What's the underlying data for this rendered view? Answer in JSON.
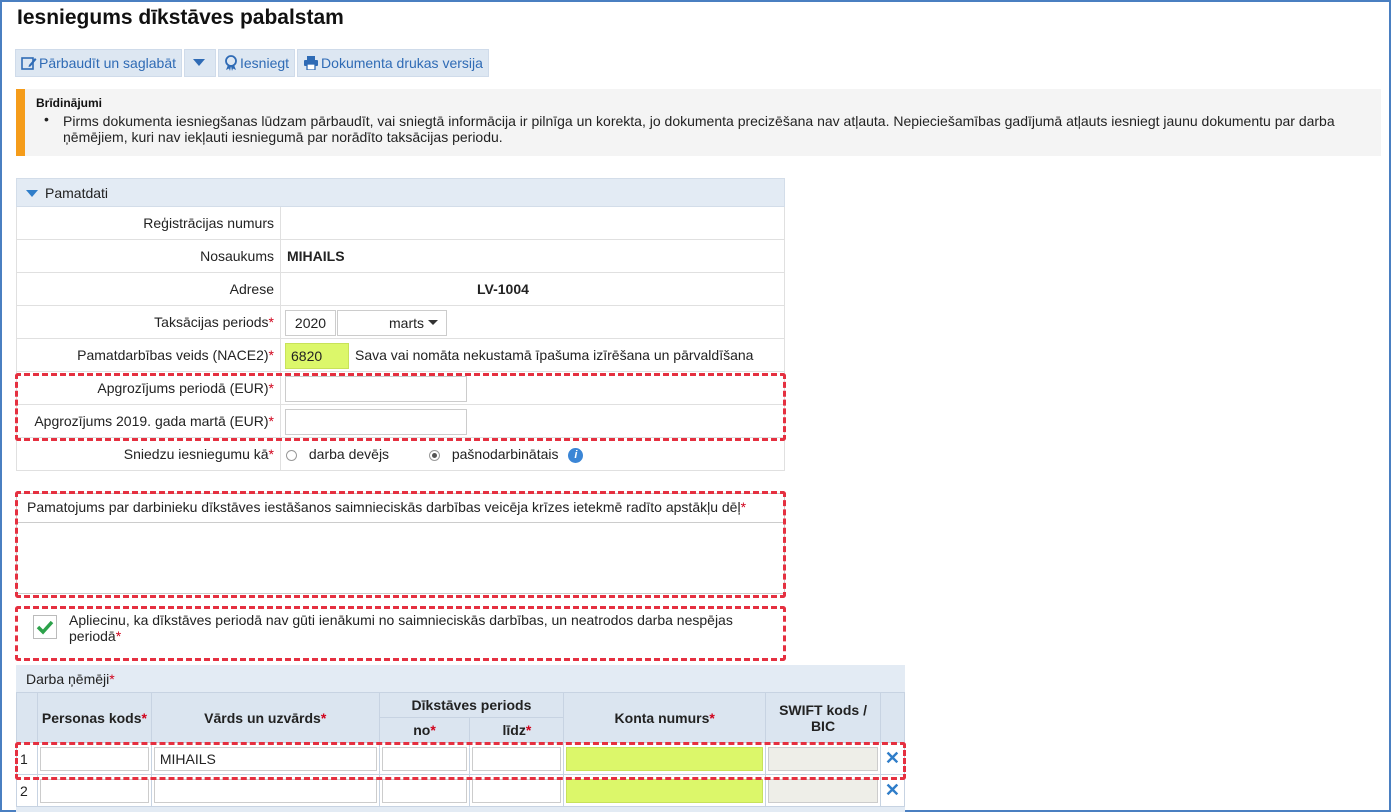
{
  "page": {
    "title": "Iesniegums dīkstāves pabalstam"
  },
  "toolbar": {
    "check_save": "Pārbaudīt un saglabāt",
    "submit": "Iesniegt",
    "print": "Dokumenta drukas versija"
  },
  "warnings": {
    "title": "Brīdinājumi",
    "items": [
      "Pirms dokumenta iesniegšanas lūdzam pārbaudīt, vai sniegtā informācija ir pilnīga un korekta, jo dokumenta precizēšana nav atļauta. Nepieciešamības gadījumā atļauts iesniegt jaunu dokumentu par darba ņēmējiem, kuri nav iekļauti iesniegumā par norādīto taksācijas periodu."
    ]
  },
  "basic": {
    "section_title": "Pamatdati",
    "reg_label": "Reģistrācijas numurs",
    "reg_value": "",
    "name_label": "Nosaukums",
    "name_value": "MIHAILS",
    "address_label": "Adrese",
    "address_value": "LV-1004",
    "period_label": "Taksācijas periods",
    "period_year": "2020",
    "period_month": "marts",
    "nace_label": "Pamatdarbības veids (NACE2)",
    "nace_code": "6820",
    "nace_desc": "Sava vai nomāta nekustamā īpašuma izīrēšana un pārvaldīšana",
    "turnover_label": "Apgrozījums periodā (EUR)",
    "turnover_value": "",
    "turnover2019_label": "Apgrozījums 2019. gada martā (EUR)",
    "turnover2019_value": "",
    "submit_as_label": "Sniedzu iesniegumu kā",
    "option_employer": "darba devējs",
    "option_selfemployed": "pašnodarbinātais",
    "selected": "pašnodarbinātais",
    "req_mark": "*"
  },
  "justification": {
    "label": "Pamatojums par darbinieku dīkstāves iestāšanos saimnieciskās darbības veicēja krīzes ietekmē radīto apstākļu dēļ",
    "value": ""
  },
  "confirm": {
    "text": "Apliecinu, ka dīkstāves periodā nav gūti ienākumi no saimnieciskās darbības, un neatrodos darba nespējas periodā",
    "checked": true
  },
  "employees": {
    "title": "Darba ņēmēji",
    "headers": {
      "personal_code": "Personas kods",
      "name": "Vārds un uzvārds",
      "idle_period": "Dīkstāves periods",
      "from": "no",
      "to": "līdz",
      "account": "Konta numurs",
      "swift": "SWIFT kods / BIC"
    },
    "rows": [
      {
        "num": "1",
        "personal_code": "",
        "name": "MIHAILS",
        "from": "",
        "to": "",
        "account": "",
        "swift": ""
      },
      {
        "num": "2",
        "personal_code": "",
        "name": "",
        "from": "",
        "to": "",
        "account": "",
        "swift": ""
      }
    ]
  },
  "colors": {
    "accent": "#2f7dc9",
    "warning_bar": "#f59c1a",
    "highlight": "#dcf76a",
    "required": "#d0021b",
    "error_outline": "#e53040"
  }
}
